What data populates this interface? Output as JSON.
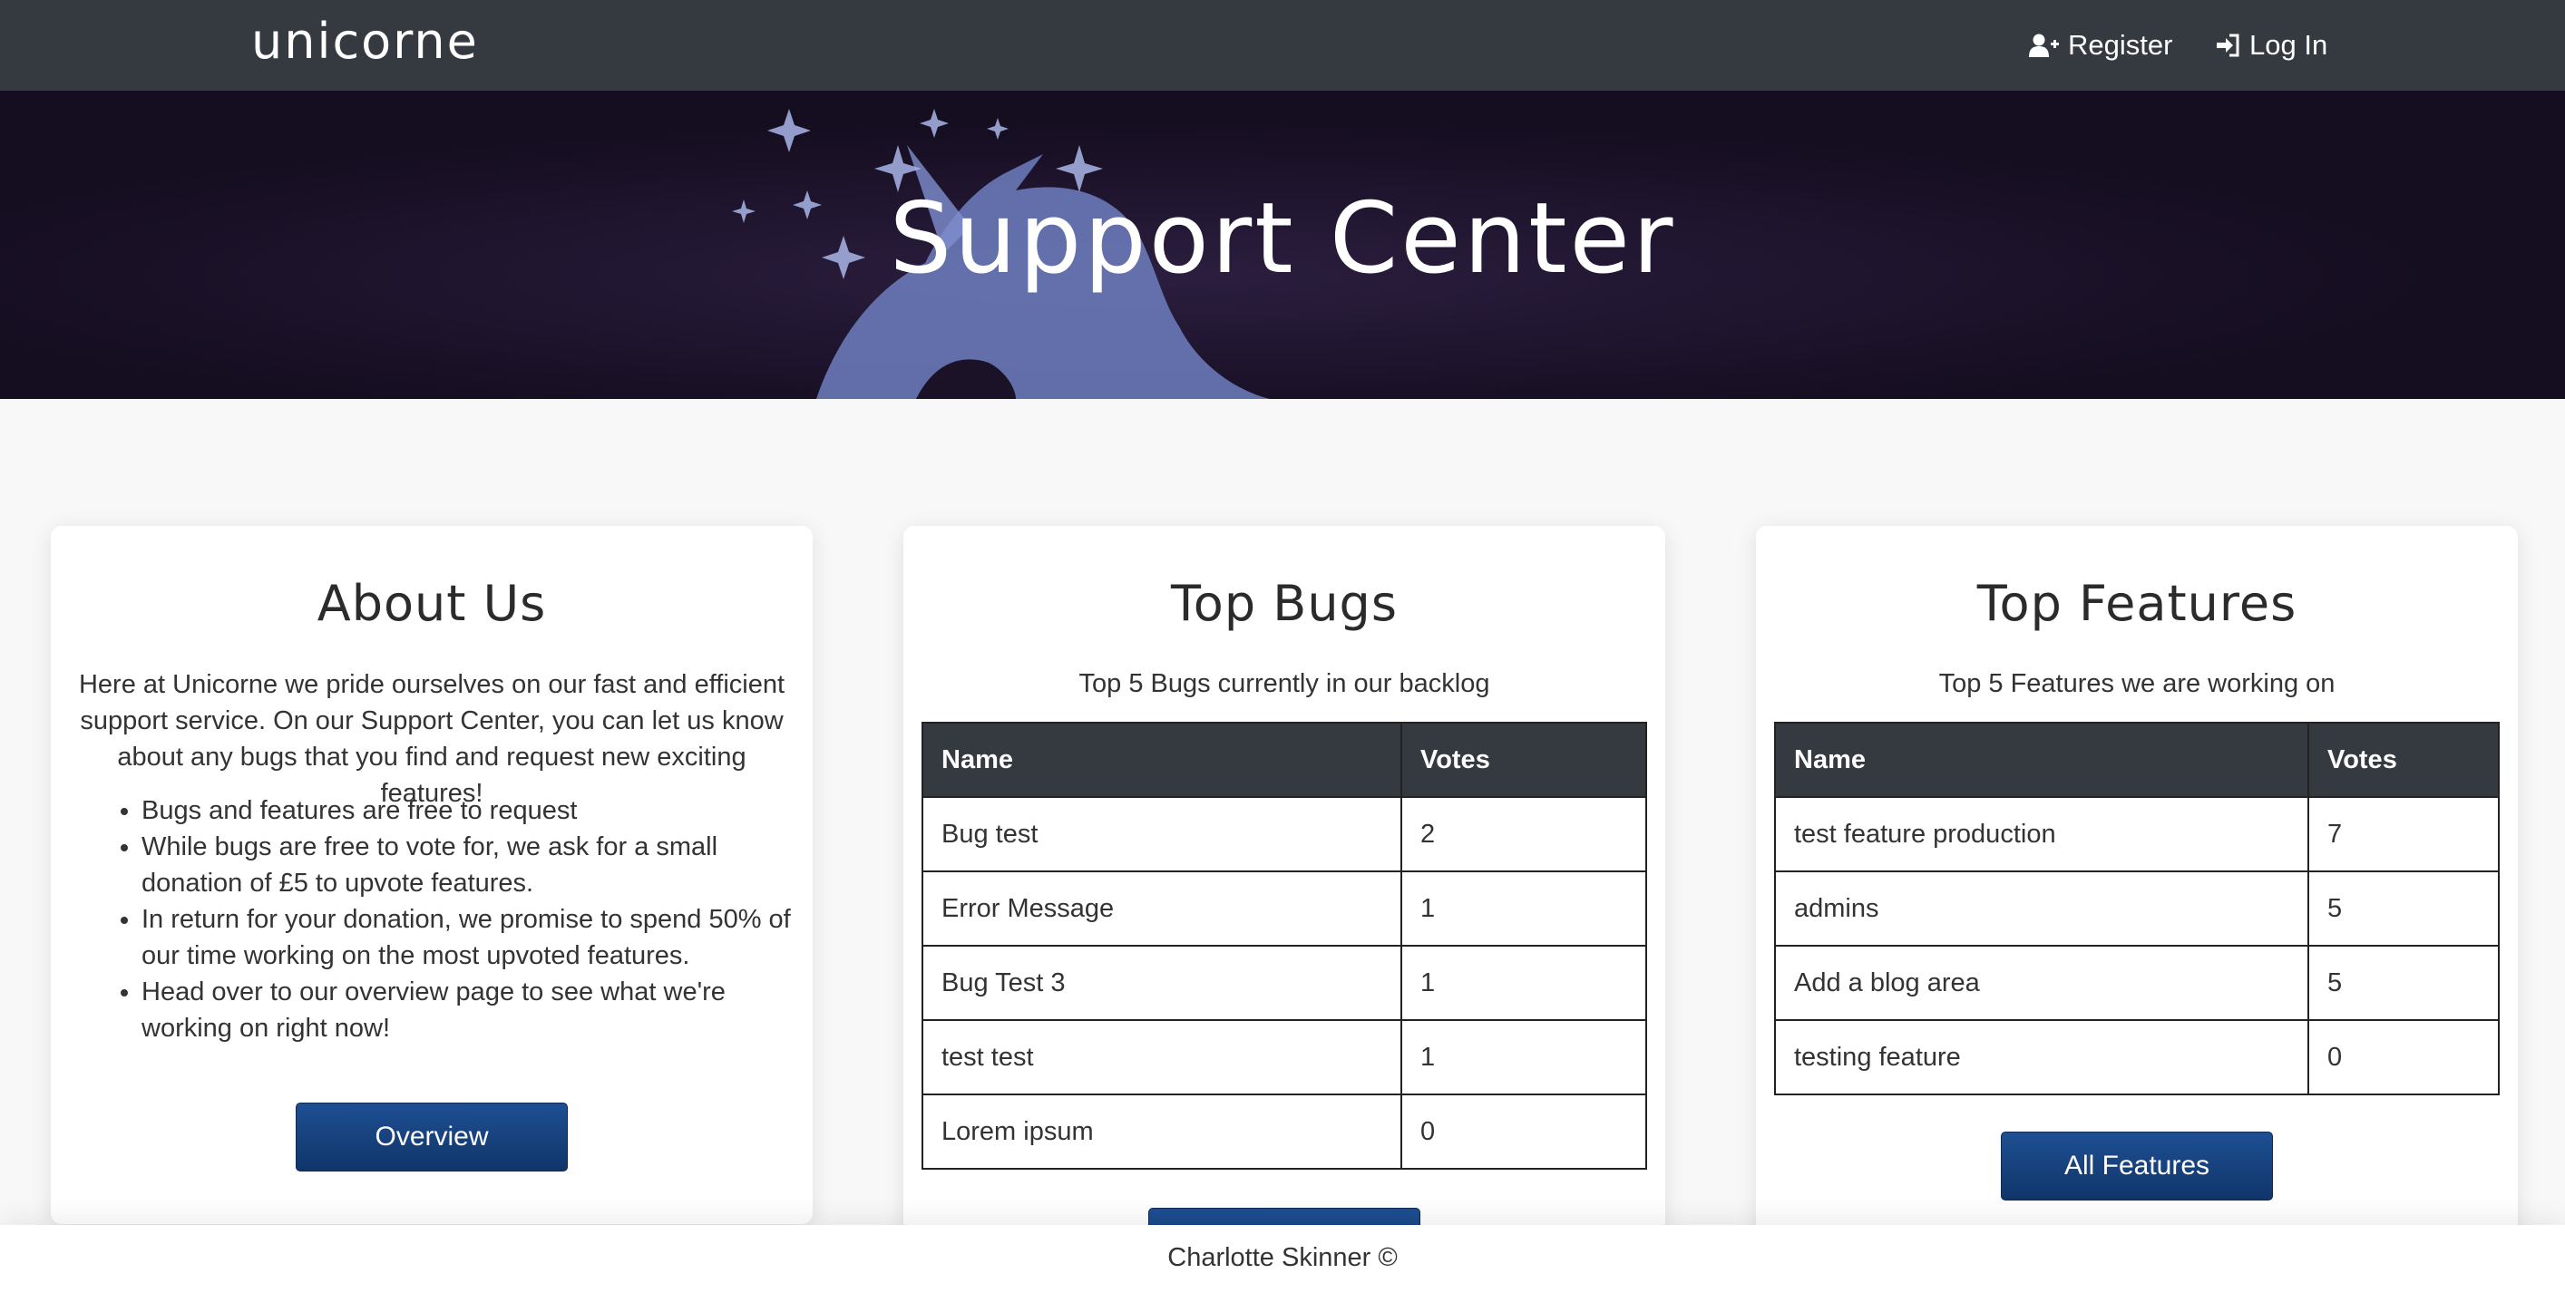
{
  "navbar": {
    "brand": "unicorne",
    "register_label": "Register",
    "login_label": "Log In"
  },
  "hero": {
    "title": "Support Center"
  },
  "about": {
    "title": "About Us",
    "text": "Here at Unicorne we pride ourselves on our fast and efficient support service. On our Support Center, you can let us know about any bugs that you find and request new exciting features!",
    "bullets": [
      "Bugs and features are free to request",
      "While bugs are free to vote for, we ask for a small donation of £5 to upvote features.",
      "In return for your donation, we promise to spend 50% of our time working on the most upvoted features.",
      "Head over to our overview page to see what we're working on right now!"
    ],
    "button_label": "Overview"
  },
  "bugs": {
    "title": "Top Bugs",
    "subtitle": "Top 5 Bugs currently in our backlog",
    "columns": [
      "Name",
      "Votes"
    ],
    "rows": [
      {
        "name": "Bug test",
        "votes": "2"
      },
      {
        "name": "Error Message",
        "votes": "1"
      },
      {
        "name": "Bug Test 3",
        "votes": "1"
      },
      {
        "name": "test test",
        "votes": "1"
      },
      {
        "name": "Lorem ipsum",
        "votes": "0"
      }
    ],
    "button_label": ""
  },
  "features": {
    "title": "Top Features",
    "subtitle": "Top 5 Features we are working on",
    "columns": [
      "Name",
      "Votes"
    ],
    "rows": [
      {
        "name": "test feature production",
        "votes": "7"
      },
      {
        "name": "admins",
        "votes": "5"
      },
      {
        "name": "Add a blog area",
        "votes": "5"
      },
      {
        "name": "testing feature",
        "votes": "0"
      }
    ],
    "button_label": "All Features"
  },
  "footer": {
    "text": "Charlotte Skinner ©"
  },
  "colors": {
    "navbar": "#343a40",
    "hero_bg": "#1b1228",
    "button": "#1a4585",
    "page_bg": "#f8f8f8"
  }
}
